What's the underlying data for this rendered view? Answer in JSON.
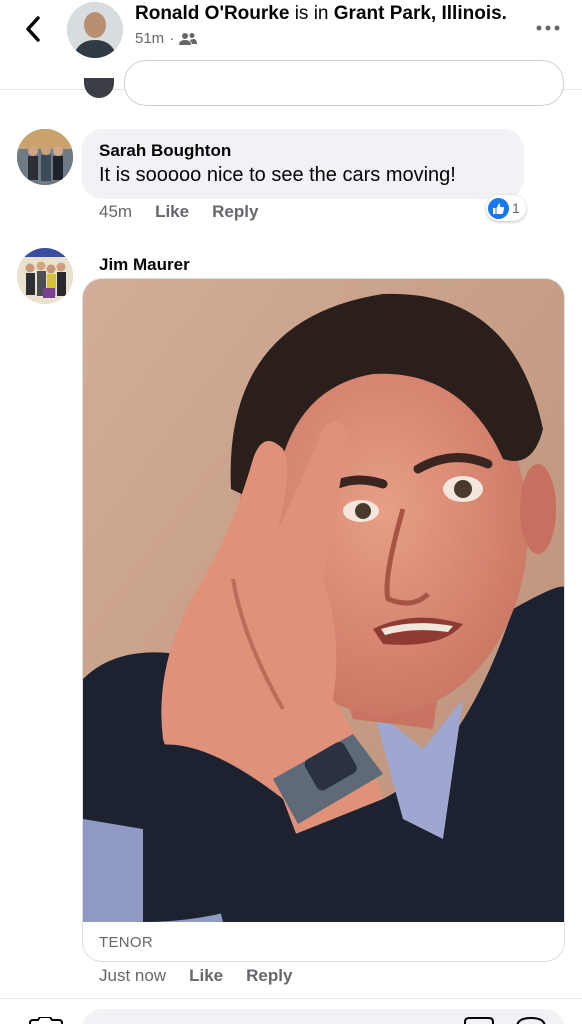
{
  "header": {
    "author": "Ronald O'Rourke",
    "connector": "is in",
    "location": "Grant Park, Illinois.",
    "time": "51m",
    "audience_icon": "friends-icon",
    "back_icon": "chevron-left-icon",
    "more_icon": "more-horizontal-icon"
  },
  "comments": [
    {
      "author": "Sarah Boughton",
      "text": "It is sooooo nice to see the cars moving!",
      "time": "45m",
      "like_label": "Like",
      "reply_label": "Reply",
      "reaction_icon": "like-reaction-icon",
      "reaction_count": "1"
    },
    {
      "author": "Jim Maurer",
      "gif_source": "TENOR",
      "time": "Just now",
      "like_label": "Like",
      "reply_label": "Reply"
    }
  ],
  "colors": {
    "accent": "#1877f2",
    "secondary_text": "#65676b",
    "bubble": "#f0f2f5"
  }
}
